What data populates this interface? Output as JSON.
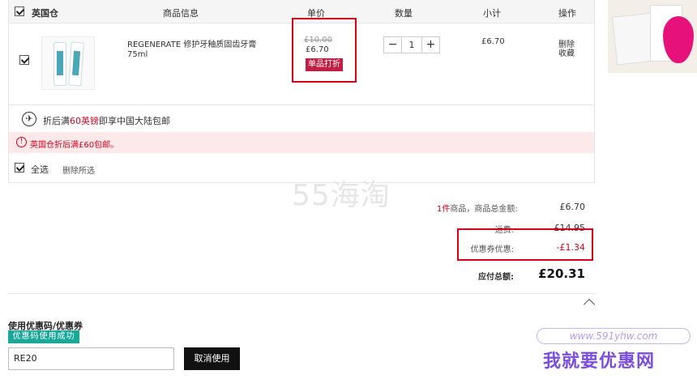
{
  "cart": {
    "warehouse_label": "英国仓",
    "columns": {
      "product_info": "商品信息",
      "unit_price": "单价",
      "quantity": "数量",
      "subtotal": "小计",
      "actions": "操作"
    },
    "item": {
      "name_line1": "REGENERATE 修护牙釉质固齿牙膏",
      "name_line2": "75ml",
      "original_price": "£10.00",
      "price": "£6.70",
      "discount_badge": "单品打折",
      "quantity": "1",
      "subtotal": "£6.70",
      "delete_label": "删除",
      "favorite_label": "收藏",
      "thumb_brand": "REGENERATE"
    },
    "shipping_notice": {
      "prefix": "折后满",
      "amount": "60英镑",
      "suffix": "即享中国大陆包邮"
    },
    "warning": "英国仓折后满£60包邮。",
    "select_all": "全选",
    "delete_selected": "删除所选"
  },
  "watermark": "55海淘",
  "summary": {
    "count": "1件",
    "total_label": "商品，商品总金额:",
    "total_value": "£6.70",
    "shipping_label": "运费:",
    "shipping_value": "£14.95",
    "coupon_label": "优惠券优惠:",
    "coupon_value": "-£1.34",
    "grand_label": "应付总额:",
    "grand_value": "£20.31"
  },
  "coupon": {
    "title": "使用优惠码/优惠券",
    "success": "优惠码使用成功",
    "code": "RE20",
    "cancel_button": "取消使用"
  },
  "overlay": {
    "site_url": "www.591yhw.com",
    "site_name": "我就要优惠网"
  },
  "colors": {
    "accent_red": "#d9001b",
    "badge_red": "#c21e43",
    "success_teal": "#19a89a",
    "warn_bg": "#fde8ea"
  }
}
